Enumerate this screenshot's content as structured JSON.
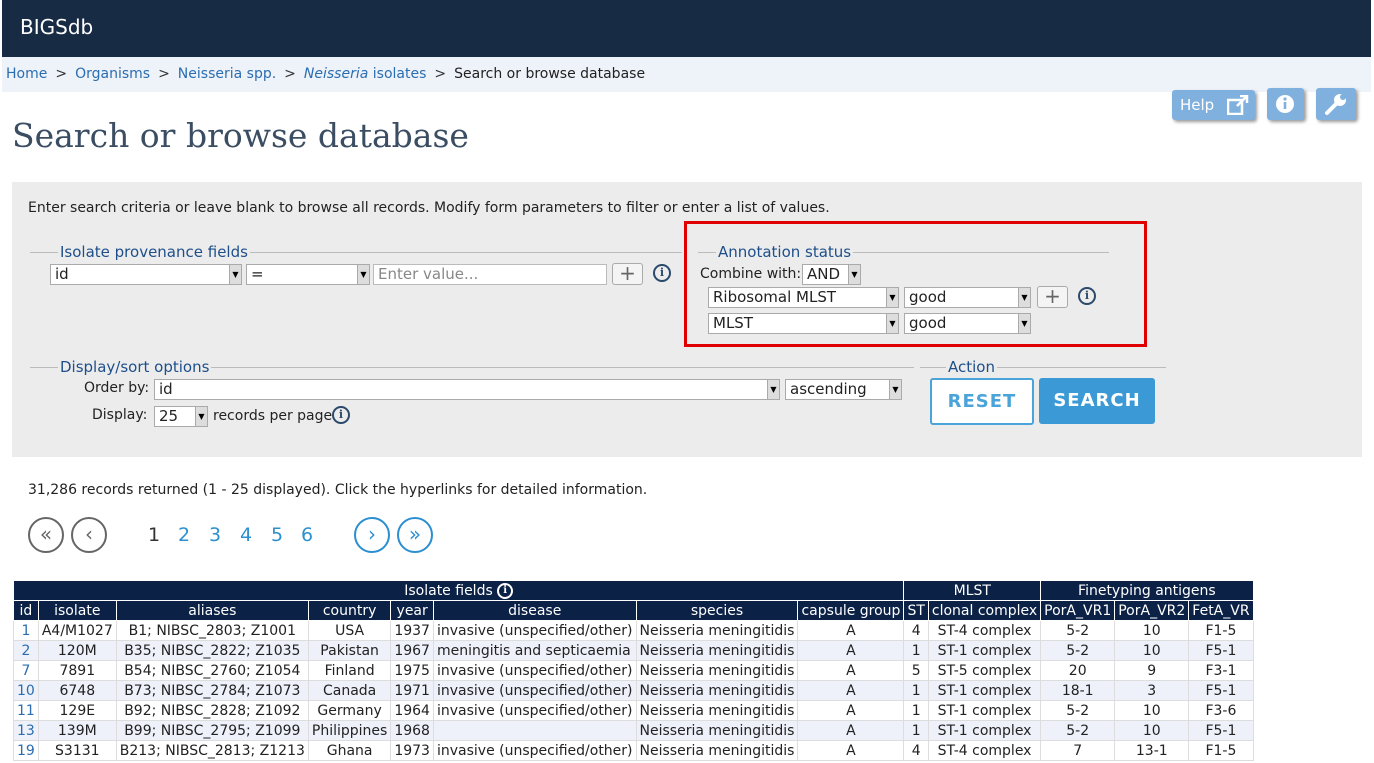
{
  "app": {
    "title": "BIGSdb"
  },
  "breadcrumb": {
    "items": [
      "Home",
      "Organisms",
      "Neisseria spp.",
      "Neisseria",
      "isolates",
      "Search or browse database"
    ],
    "sep": ">"
  },
  "toolbar": {
    "help_label": "Help"
  },
  "page": {
    "title": "Search or browse database"
  },
  "form": {
    "intro": "Enter search criteria or leave blank to browse all records. Modify form parameters to filter or enter a list of values.",
    "provenance": {
      "legend": "Isolate provenance fields",
      "field": "id",
      "operator": "=",
      "value_placeholder": "Enter value..."
    },
    "annotation": {
      "legend": "Annotation status",
      "combine_label": "Combine with:",
      "combine_value": "AND",
      "rows": [
        {
          "scheme": "Ribosomal MLST",
          "status": "good"
        },
        {
          "scheme": "MLST",
          "status": "good"
        }
      ]
    },
    "display": {
      "legend": "Display/sort options",
      "order_label": "Order by:",
      "order_value": "id",
      "direction": "ascending",
      "display_label": "Display:",
      "per_page": "25",
      "per_page_suffix": "records per page"
    },
    "action": {
      "legend": "Action",
      "reset": "RESET",
      "search": "SEARCH"
    }
  },
  "results": {
    "summary": "31,286 records returned (1 - 25 displayed). Click the hyperlinks for detailed information.",
    "pages": [
      "1",
      "2",
      "3",
      "4",
      "5",
      "6"
    ],
    "current_page": "1"
  },
  "table": {
    "group_headers": [
      "Isolate fields",
      "MLST",
      "Finetyping antigens"
    ],
    "columns": [
      "id",
      "isolate",
      "aliases",
      "country",
      "year",
      "disease",
      "species",
      "capsule group",
      "ST",
      "clonal complex",
      "PorA_VR1",
      "PorA_VR2",
      "FetA_VR"
    ],
    "rows": [
      [
        "1",
        "A4/M1027",
        "B1; NIBSC_2803; Z1001",
        "USA",
        "1937",
        "invasive (unspecified/other)",
        "Neisseria meningitidis",
        "A",
        "4",
        "ST-4 complex",
        "5-2",
        "10",
        "F1-5"
      ],
      [
        "2",
        "120M",
        "B35; NIBSC_2822; Z1035",
        "Pakistan",
        "1967",
        "meningitis and septicaemia",
        "Neisseria meningitidis",
        "A",
        "1",
        "ST-1 complex",
        "5-2",
        "10",
        "F5-1"
      ],
      [
        "7",
        "7891",
        "B54; NIBSC_2760; Z1054",
        "Finland",
        "1975",
        "invasive (unspecified/other)",
        "Neisseria meningitidis",
        "A",
        "5",
        "ST-5 complex",
        "20",
        "9",
        "F3-1"
      ],
      [
        "10",
        "6748",
        "B73; NIBSC_2784; Z1073",
        "Canada",
        "1971",
        "invasive (unspecified/other)",
        "Neisseria meningitidis",
        "A",
        "1",
        "ST-1 complex",
        "18-1",
        "3",
        "F5-1"
      ],
      [
        "11",
        "129E",
        "B92; NIBSC_2828; Z1092",
        "Germany",
        "1964",
        "invasive (unspecified/other)",
        "Neisseria meningitidis",
        "A",
        "1",
        "ST-1 complex",
        "5-2",
        "10",
        "F3-6"
      ],
      [
        "13",
        "139M",
        "B99; NIBSC_2795; Z1099",
        "Philippines",
        "1968",
        "",
        "Neisseria meningitidis",
        "A",
        "1",
        "ST-1 complex",
        "5-2",
        "10",
        "F5-1"
      ],
      [
        "19",
        "S3131",
        "B213; NIBSC_2813; Z1213",
        "Ghana",
        "1973",
        "invasive (unspecified/other)",
        "Neisseria meningitidis",
        "A",
        "4",
        "ST-4 complex",
        "7",
        "13-1",
        "F1-5"
      ]
    ]
  }
}
